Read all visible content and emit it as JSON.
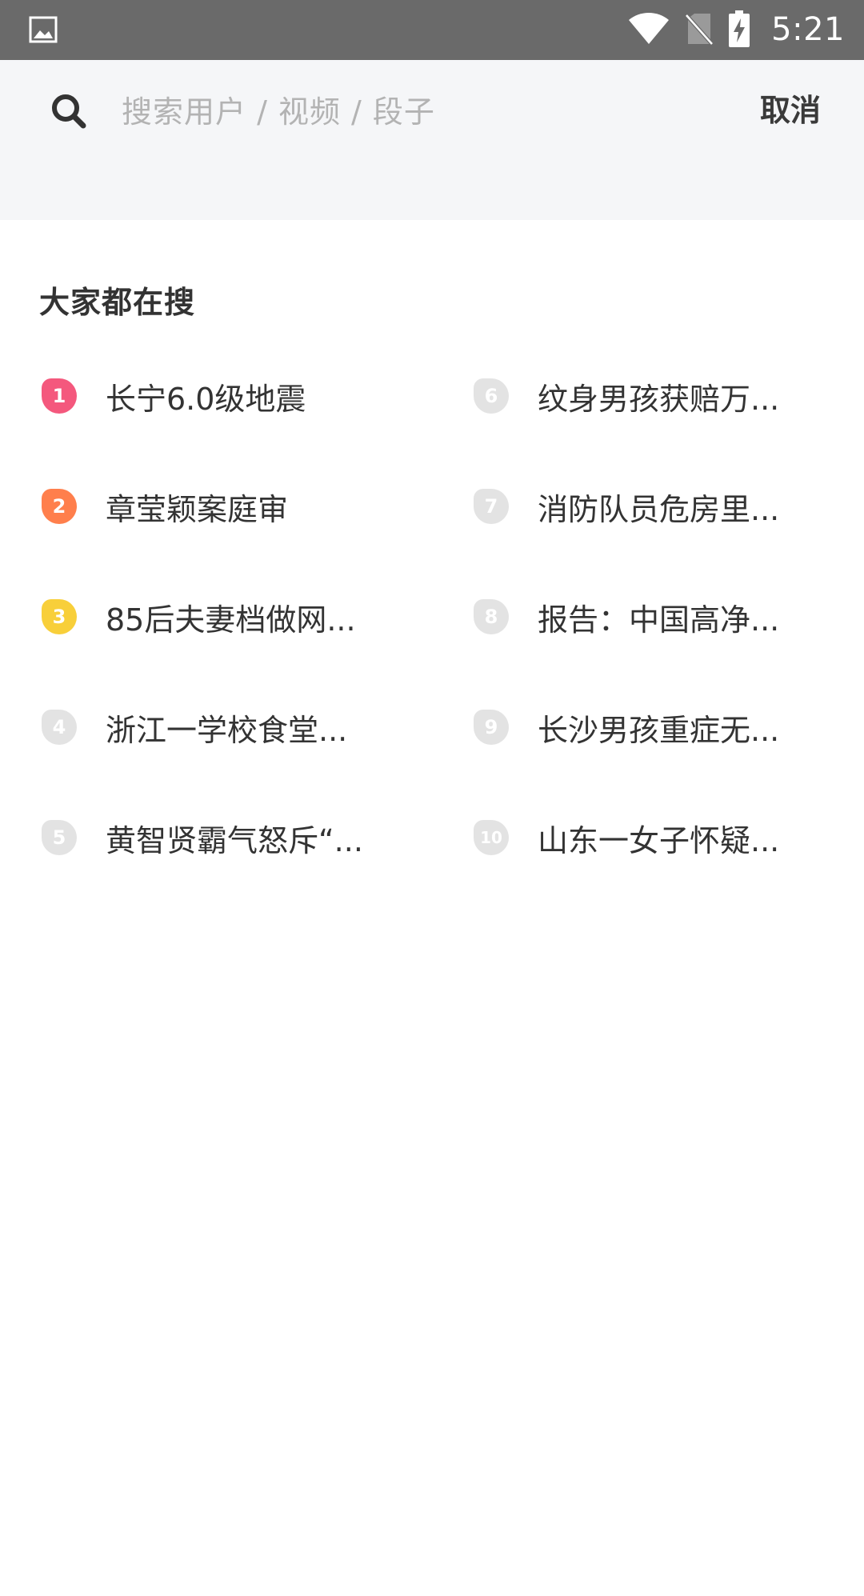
{
  "status_bar": {
    "time": "5:21",
    "icons": [
      "image-icon",
      "wifi-icon",
      "no-sim-icon",
      "battery-charging-icon"
    ]
  },
  "search": {
    "placeholder": "搜索用户 / 视频 / 段子",
    "value": "",
    "cancel_label": "取消"
  },
  "section": {
    "title": "大家都在搜"
  },
  "colors": {
    "rank1": "#f4587d",
    "rank2": "#ff7f4c",
    "rank3": "#f8cf3a",
    "rank_other": "#e3e3e3"
  },
  "hot_items": [
    {
      "rank": "1",
      "text": "长宁6.0级地震"
    },
    {
      "rank": "2",
      "text": "章莹颖案庭审"
    },
    {
      "rank": "3",
      "text": "85后夫妻档做网..."
    },
    {
      "rank": "4",
      "text": "浙江一学校食堂..."
    },
    {
      "rank": "5",
      "text": "黄智贤霸气怒斥“..."
    },
    {
      "rank": "6",
      "text": "纹身男孩获赔万..."
    },
    {
      "rank": "7",
      "text": "消防队员危房里..."
    },
    {
      "rank": "8",
      "text": "报告：中国高净..."
    },
    {
      "rank": "9",
      "text": "长沙男孩重症无..."
    },
    {
      "rank": "10",
      "text": "山东一女子怀疑..."
    }
  ]
}
